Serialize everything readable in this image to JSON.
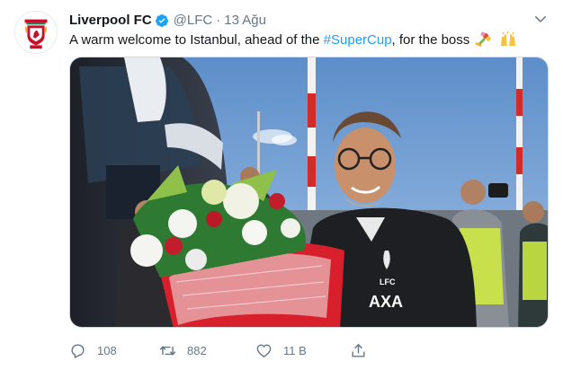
{
  "tweet": {
    "author_name": "Liverpool FC",
    "handle": "@LFC",
    "separator": "·",
    "date": "13 Ağu",
    "text_before": "A warm welcome to Istanbul, ahead of the ",
    "hashtag": "#SuperCup",
    "text_after": ", for the boss",
    "emojis": [
      "bouquet-emoji",
      "raising-hands-emoji"
    ]
  },
  "avatar": {
    "icon": "liverpool-crest-icon",
    "crest_text": "LFC"
  },
  "media": {
    "kit_badge_text": "LFC",
    "sponsor_text": "AXA"
  },
  "actions": {
    "reply_count": "108",
    "retweet_count": "882",
    "like_count": "11 B"
  },
  "colors": {
    "link": "#1da1f2",
    "muted": "#657786",
    "verified": "#1da1f2",
    "crest_red": "#c8102e"
  }
}
